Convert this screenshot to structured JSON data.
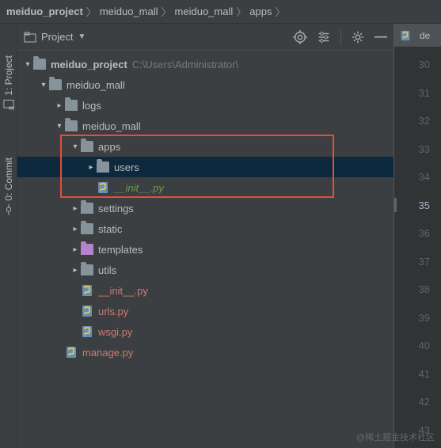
{
  "breadcrumb": [
    "meiduo_project",
    "meiduo_mall",
    "meiduo_mall",
    "apps"
  ],
  "panel": {
    "title": "Project"
  },
  "tree": {
    "root": {
      "name": "meiduo_project",
      "path": "C:\\Users\\Administrator\\"
    },
    "l1_mall": "meiduo_mall",
    "logs": "logs",
    "l2_mall": "meiduo_mall",
    "apps": "apps",
    "users": "users",
    "init_green": "__init__.py",
    "settings": "settings",
    "static": "static",
    "templates": "templates",
    "utils": "utils",
    "init_red": "__init__.py",
    "urls": "urls.py",
    "wsgi": "wsgi.py",
    "manage": "manage.py"
  },
  "editor": {
    "tab": "de",
    "lines": [
      "30",
      "31",
      "32",
      "33",
      "34",
      "35",
      "36",
      "37",
      "38",
      "39",
      "40",
      "41",
      "42",
      "43"
    ],
    "current": "35"
  },
  "watermark": "@稀土掘金技术社区"
}
